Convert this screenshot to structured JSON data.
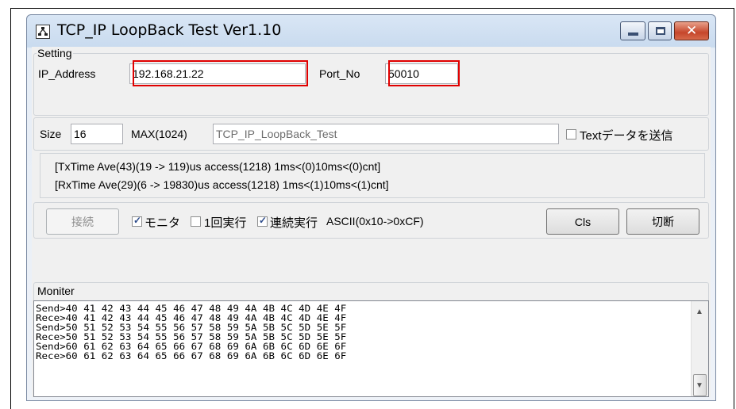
{
  "window": {
    "title": "TCP_IP LoopBack Test Ver1.10",
    "icon": "network-icon"
  },
  "setting": {
    "group_label": "Setting",
    "ip_label": "IP_Address",
    "ip_value": "192.168.21.22",
    "port_label": "Port_No",
    "port_value": "50010"
  },
  "payload": {
    "size_label": "Size",
    "size_value": "16",
    "max_label": "MAX(1024)",
    "text_value": "TCP_IP_LoopBack_Test",
    "send_text_label": "Textデータを送信",
    "send_text_checked": false
  },
  "stats": {
    "tx": "[TxTime Ave(43)(19 -> 119)us access(1218) 1ms<(0)10ms<(0)cnt]",
    "rx": "[RxTime Ave(29)(6 -> 19830)us access(1218) 1ms<(1)10ms<(1)cnt]"
  },
  "controls": {
    "connect_label": "接続",
    "monitor_label": "モニタ",
    "monitor_checked": true,
    "once_label": "1回実行",
    "once_checked": false,
    "continuous_label": "連続実行",
    "continuous_checked": true,
    "ascii_label": "ASCII(0x10->0xCF)",
    "cls_label": "Cls",
    "disconnect_label": "切断"
  },
  "monitor": {
    "group_label": "Moniter",
    "lines": [
      "Send>40 41 42 43 44 45 46 47 48 49 4A 4B 4C 4D 4E 4F",
      "Rece>40 41 42 43 44 45 46 47 48 49 4A 4B 4C 4D 4E 4F",
      "Send>50 51 52 53 54 55 56 57 58 59 5A 5B 5C 5D 5E 5F",
      "Rece>50 51 52 53 54 55 56 57 58 59 5A 5B 5C 5D 5E 5F",
      "Send>60 61 62 63 64 65 66 67 68 69 6A 6B 6C 6D 6E 6F",
      "Rece>60 61 62 63 64 65 66 67 68 69 6A 6B 6C 6D 6E 6F"
    ]
  },
  "colors": {
    "highlight_box": "#e00000",
    "close_button": "#c6462b"
  }
}
